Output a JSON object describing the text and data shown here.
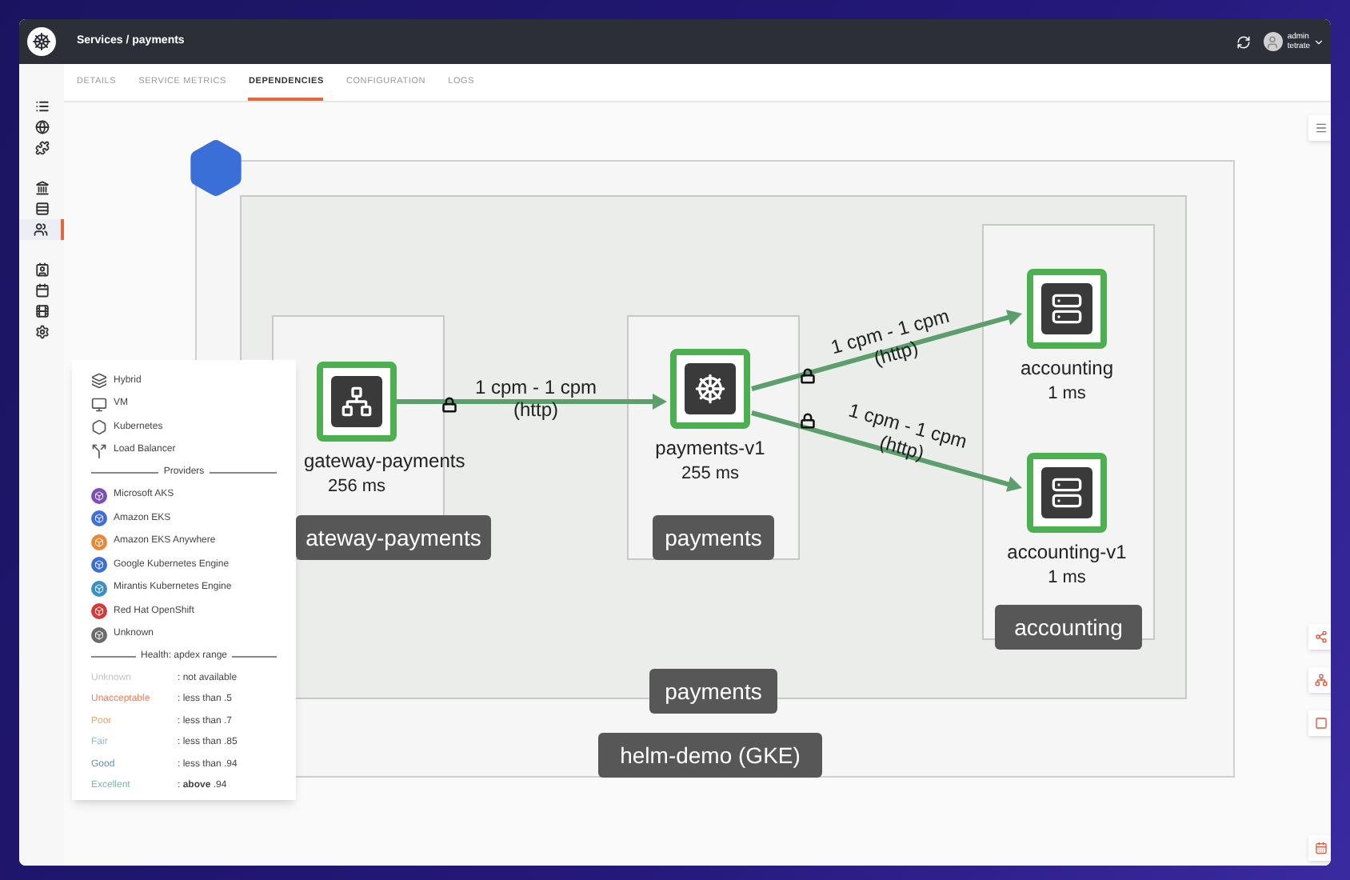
{
  "header": {
    "breadcrumb": "Services / payments",
    "user_name": "admin",
    "user_org": "tetrate"
  },
  "tabs": [
    {
      "label": "DETAILS",
      "selected": false
    },
    {
      "label": "SERVICE METRICS",
      "selected": false
    },
    {
      "label": "DEPENDENCIES",
      "selected": true
    },
    {
      "label": "CONFIGURATION",
      "selected": false
    },
    {
      "label": "LOGS",
      "selected": false
    }
  ],
  "rail": [
    {
      "selected": false
    },
    {
      "selected": false
    },
    {
      "selected": false
    },
    {
      "selected": false
    },
    {
      "selected": false
    },
    {
      "selected": true
    },
    {
      "selected": false
    },
    {
      "selected": false
    },
    {
      "selected": false
    },
    {
      "selected": false
    }
  ],
  "diagram": {
    "cluster": {
      "label": "helm-demo (GKE)"
    },
    "namespace": {
      "label": "payments"
    },
    "services": [
      {
        "label": "ateway-payments",
        "nodes": [
          {
            "name": "gateway-payments",
            "latency": "256 ms"
          }
        ]
      },
      {
        "label": "payments",
        "nodes": [
          {
            "name": "payments-v1",
            "latency": "255 ms"
          }
        ]
      },
      {
        "label": "accounting",
        "nodes": [
          {
            "name": "accounting",
            "latency": "1 ms"
          },
          {
            "name": "accounting-v1",
            "latency": "1 ms"
          }
        ]
      }
    ],
    "edges": [
      {
        "rate": "1 cpm - 1 cpm",
        "protocol": "(http)"
      },
      {
        "rate": "1 cpm - 1 cpm",
        "protocol": "(http)"
      },
      {
        "rate": "1 cpm - 1 cpm",
        "protocol": "(http)"
      }
    ]
  },
  "legend": {
    "types": [
      "Hybrid",
      "VM",
      "Kubernetes",
      "Load Balancer"
    ],
    "providers_title": "Providers",
    "providers": [
      {
        "label": "Microsoft AKS",
        "color": "#7b4fb5"
      },
      {
        "label": "Amazon EKS",
        "color": "#3f6fd8"
      },
      {
        "label": "Amazon EKS Anywhere",
        "color": "#e8893a"
      },
      {
        "label": "Google Kubernetes Engine",
        "color": "#3b6fd6"
      },
      {
        "label": "Mirantis Kubernetes Engine",
        "color": "#3b8fc4"
      },
      {
        "label": "Red Hat OpenShift",
        "color": "#d33a3a"
      },
      {
        "label": "Unknown",
        "color": "#6b6b6b"
      }
    ],
    "health_title": "Health: apdex range",
    "health": [
      {
        "label": "Unknown",
        "range": ": not available",
        "color": "#c4c4c4"
      },
      {
        "label": "Unacceptable",
        "range": ": less than .5",
        "color": "#ef7d5e"
      },
      {
        "label": "Poor",
        "range": ": less than .7",
        "color": "#f0a070"
      },
      {
        "label": "Fair",
        "range": ": less than .85",
        "color": "#8fb8e0"
      },
      {
        "label": "Good",
        "range": ": less than .94",
        "color": "#5f8fbf"
      },
      {
        "label": "Excellent",
        "range": ": **above** .94",
        "color": "#7fb8a8"
      }
    ]
  }
}
